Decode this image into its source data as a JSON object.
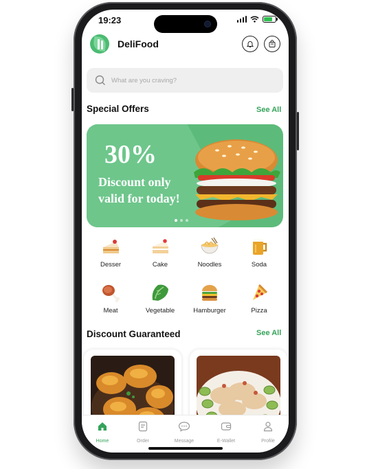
{
  "status": {
    "time": "19:23"
  },
  "app": {
    "name": "DeliFood"
  },
  "search": {
    "placeholder": "What are you craving?"
  },
  "special_offers": {
    "title": "Special Offers",
    "see_all": "See All",
    "banner": {
      "discount": "30%",
      "line1": "Discount only",
      "line2": "valid for today!"
    },
    "carousel_pages": 3,
    "active_page": 1
  },
  "categories": [
    {
      "label": "Desser",
      "icon": "cake-slice-icon"
    },
    {
      "label": "Cake",
      "icon": "cake-icon"
    },
    {
      "label": "Noodles",
      "icon": "noodles-icon"
    },
    {
      "label": "Soda",
      "icon": "beer-mug-icon"
    },
    {
      "label": "Meat",
      "icon": "meat-leg-icon"
    },
    {
      "label": "Vegetable",
      "icon": "lettuce-icon"
    },
    {
      "label": "Hamburger",
      "icon": "hamburger-icon"
    },
    {
      "label": "Pizza",
      "icon": "pizza-slice-icon"
    }
  ],
  "discount_guaranteed": {
    "title": "Discount Guaranteed",
    "see_all": "See All"
  },
  "nav": [
    {
      "label": "Home",
      "icon": "home-icon",
      "active": true
    },
    {
      "label": "Order",
      "icon": "order-icon",
      "active": false
    },
    {
      "label": "Message",
      "icon": "message-icon",
      "active": false
    },
    {
      "label": "E-Wallet",
      "icon": "wallet-icon",
      "active": false
    },
    {
      "label": "Profile",
      "icon": "profile-icon",
      "active": false
    }
  ],
  "colors": {
    "accent": "#35a35a",
    "banner": "#5cbb7a"
  }
}
